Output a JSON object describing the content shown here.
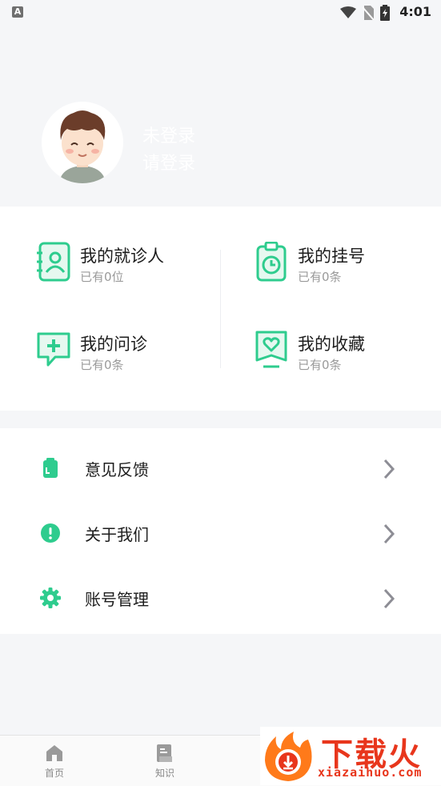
{
  "status_bar": {
    "time": "4:01"
  },
  "profile": {
    "title": "未登录",
    "subtitle": "请登录"
  },
  "stats": [
    {
      "title": "我的就诊人",
      "subtitle": "已有0位",
      "icon": "patient-card-icon"
    },
    {
      "title": "我的挂号",
      "subtitle": "已有0条",
      "icon": "clipboard-clock-icon"
    },
    {
      "title": "我的问诊",
      "subtitle": "已有0条",
      "icon": "chat-plus-icon"
    },
    {
      "title": "我的收藏",
      "subtitle": "已有0条",
      "icon": "heart-bookmark-icon"
    }
  ],
  "menu": [
    {
      "label": "意见反馈",
      "icon": "feedback-icon"
    },
    {
      "label": "关于我们",
      "icon": "info-icon"
    },
    {
      "label": "账号管理",
      "icon": "gear-icon"
    }
  ],
  "tabs": [
    {
      "label": "首页",
      "icon": "home-icon"
    },
    {
      "label": "知识",
      "icon": "knowledge-icon"
    }
  ],
  "watermark": {
    "title": "下载火",
    "url": "xiazaihuo.com"
  },
  "colors": {
    "accent": "#2ecc8e",
    "background": "#f5f6f8",
    "watermark": "#e8361c"
  }
}
